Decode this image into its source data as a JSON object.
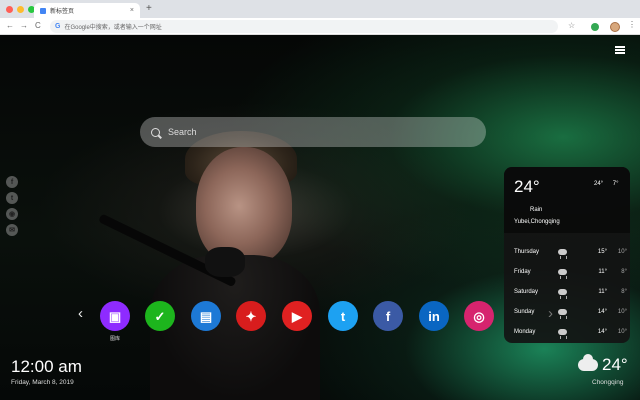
{
  "browser": {
    "tab_title": "新标签页",
    "tab_close": "×",
    "new_tab": "+",
    "omnibox_placeholder": "在Google中搜索，或者输入一个网址",
    "google_glyph": "G",
    "nav_back": "←",
    "nav_forward": "→",
    "reload": "C",
    "star": "☆",
    "menu": "⋮",
    "traffic_lights": [
      "#ff5f57",
      "#febc2e",
      "#28c840"
    ]
  },
  "search": {
    "placeholder": "Search"
  },
  "social": [
    {
      "name": "facebook-icon",
      "glyph": "f"
    },
    {
      "name": "twitter-icon",
      "glyph": "t"
    },
    {
      "name": "snapchat-icon",
      "glyph": "◉"
    },
    {
      "name": "wechat-icon",
      "glyph": "✉"
    }
  ],
  "weather_panel": {
    "temp": "24°",
    "high": "24°",
    "low": "7°",
    "condition": "Rain",
    "location": "Yubei,Chongqing",
    "forecast": [
      {
        "day": "Thursday",
        "high": "15°",
        "low": "10°"
      },
      {
        "day": "Friday",
        "high": "11°",
        "low": "8°"
      },
      {
        "day": "Saturday",
        "high": "11°",
        "low": "8°"
      },
      {
        "day": "Sunday",
        "high": "14°",
        "low": "10°"
      },
      {
        "day": "Monday",
        "high": "14°",
        "low": "10°"
      }
    ]
  },
  "dock": {
    "prev": "‹",
    "next": "›",
    "apps": [
      {
        "name": "gallery",
        "label": "图库",
        "color": "#8e2bff",
        "glyph": "▣"
      },
      {
        "name": "tasks",
        "label": "",
        "color": "#1db51d",
        "glyph": "✓"
      },
      {
        "name": "notes",
        "label": "",
        "color": "#1d79d6",
        "glyph": "▤"
      },
      {
        "name": "game",
        "label": "",
        "color": "#d81d1d",
        "glyph": "✦"
      },
      {
        "name": "youtube",
        "label": "",
        "color": "#e02121",
        "glyph": "▶"
      },
      {
        "name": "twitter",
        "label": "",
        "color": "#1da1f2",
        "glyph": "t"
      },
      {
        "name": "facebook",
        "label": "",
        "color": "#3b5aa5",
        "glyph": "f"
      },
      {
        "name": "linkedin",
        "label": "",
        "color": "#0a66c2",
        "glyph": "in"
      },
      {
        "name": "instagram",
        "label": "",
        "color": "#d6246e",
        "glyph": "◎"
      }
    ]
  },
  "clock": {
    "time": "12:00 am",
    "date": "Friday, March 8, 2019"
  },
  "bottom_weather": {
    "temp": "24°",
    "location": "Chongqing"
  }
}
